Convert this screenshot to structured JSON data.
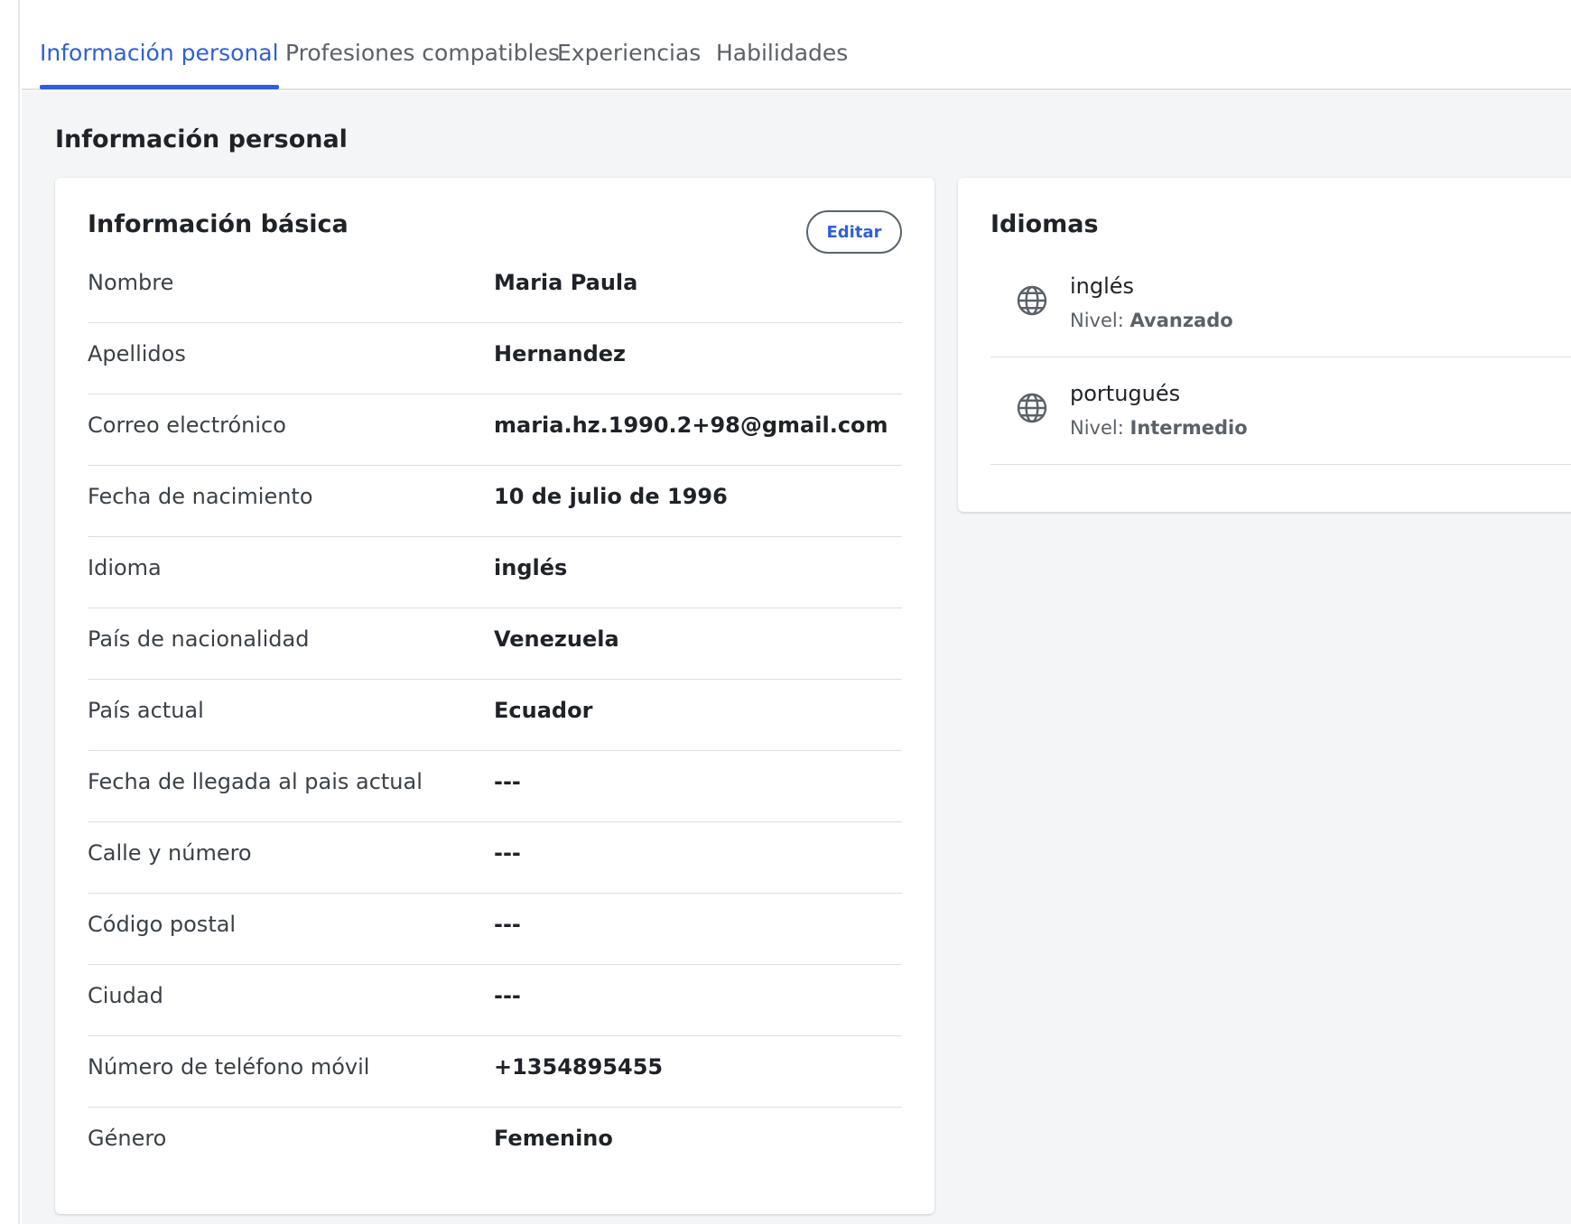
{
  "tabs": [
    {
      "label": "Información personal",
      "active": true
    },
    {
      "label": "Profesiones compatibles",
      "active": false
    },
    {
      "label": "Experiencias",
      "active": false
    },
    {
      "label": "Habilidades",
      "active": false
    }
  ],
  "section": {
    "title": "Información personal"
  },
  "basic_info": {
    "title": "Información básica",
    "edit_label": "Editar",
    "rows": [
      {
        "label": "Nombre",
        "value": "Maria Paula"
      },
      {
        "label": "Apellidos",
        "value": "Hernandez"
      },
      {
        "label": "Correo electrónico",
        "value": "maria.hz.1990.2+98@gmail.com"
      },
      {
        "label": "Fecha de nacimiento",
        "value": "10 de julio de 1996"
      },
      {
        "label": "Idioma",
        "value": "inglés"
      },
      {
        "label": "País de nacionalidad",
        "value": "Venezuela"
      },
      {
        "label": "País actual",
        "value": "Ecuador"
      },
      {
        "label": "Fecha de llegada al pais actual",
        "value": "---"
      },
      {
        "label": "Calle y número",
        "value": "---"
      },
      {
        "label": "Código postal",
        "value": "---"
      },
      {
        "label": "Ciudad",
        "value": "---"
      },
      {
        "label": "Número de teléfono móvil",
        "value": "+1354895455"
      },
      {
        "label": "Género",
        "value": "Femenino"
      }
    ]
  },
  "languages": {
    "title": "Idiomas",
    "level_prefix": "Nivel:",
    "items": [
      {
        "name": "inglés",
        "level": "Avanzado",
        "icon": "globe-icon"
      },
      {
        "name": "portugués",
        "level": "Intermedio",
        "icon": "globe-icon"
      }
    ]
  },
  "colors": {
    "accent": "#2f5fdc",
    "background": "#f4f5f7",
    "card": "#ffffff"
  }
}
